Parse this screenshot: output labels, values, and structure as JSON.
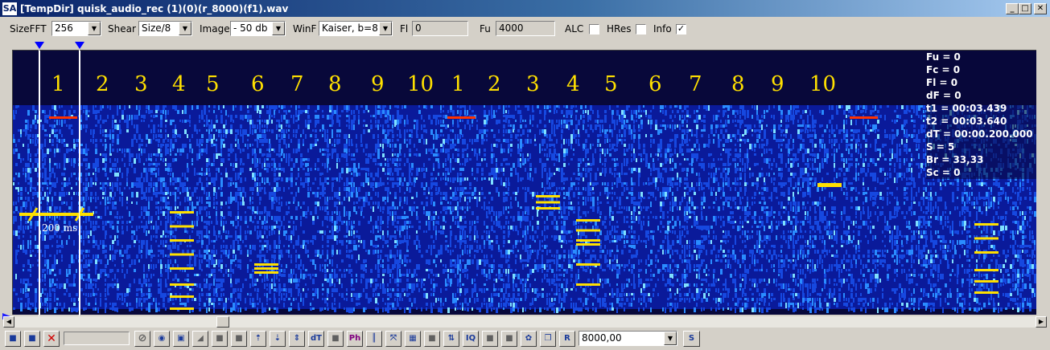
{
  "window": {
    "app_icon": "SA",
    "title": "[TempDir] quisk_audio_rec (1)(0)(r_8000)(f1).wav",
    "buttons": {
      "minimize": "_",
      "maximize": "□",
      "close": "✕"
    }
  },
  "toolbar": {
    "sizefft_label": "SizeFFT",
    "sizefft_value": "256",
    "shear_label": "Shear",
    "shear_value": "Size/8",
    "image_label": "Image",
    "image_value": "- 50 db",
    "winf_label": "WinF",
    "winf_value": "Kaiser, b=8",
    "fl_label": "Fl",
    "fl_value": "0",
    "fu_label": "Fu",
    "fu_value": "4000",
    "alc_label": "ALC",
    "alc_checked": false,
    "hres_label": "HRes",
    "hres_checked": false,
    "info_label": "Info",
    "info_checked": true
  },
  "spectrogram": {
    "element_numbers": [
      "1",
      "2",
      "3",
      "4",
      "5",
      "6",
      "7",
      "8",
      "9",
      "10",
      "1",
      "2",
      "3",
      "4",
      "5",
      "6",
      "7",
      "8",
      "9",
      "10"
    ],
    "duration_label": "200 ms",
    "info_lines": [
      "Fu = 0",
      "Fc = 0",
      "Fl = 0",
      "dF = 0",
      "t1 = 00:03.439",
      "t2 = 00:03.640",
      "dT = 00:00.200.000",
      "S = 5",
      "Br = 33,33",
      "Sc = 0"
    ],
    "colors": {
      "background": "#08083a",
      "signal": "#1a5cff",
      "hot": "#ffe000",
      "peak": "#ff3300"
    }
  },
  "bottom": {
    "icons": [
      "stop-icon",
      "pause-icon",
      "cancel-icon",
      "disable-icon",
      "speaker-icon",
      "frame-icon",
      "shade-left-icon",
      "shade-mid-icon",
      "shade-right-icon",
      "arrow-up-icon",
      "arrow-down-icon",
      "arrow-updown-icon",
      "dt-icon",
      "blank-icon",
      "ph-icon",
      "bars-icon",
      "cross-icon",
      "grid-icon",
      "blank2-icon",
      "sort-icon",
      "iq-icon",
      "blank3-icon",
      "blank4-icon",
      "cycle-icon",
      "copy-icon",
      "r-icon"
    ],
    "dt_label": "dT",
    "ph_label": "Ph",
    "iq_label": "IQ",
    "r_label": "R",
    "rate_value": "8000,00",
    "s_label": "S"
  }
}
